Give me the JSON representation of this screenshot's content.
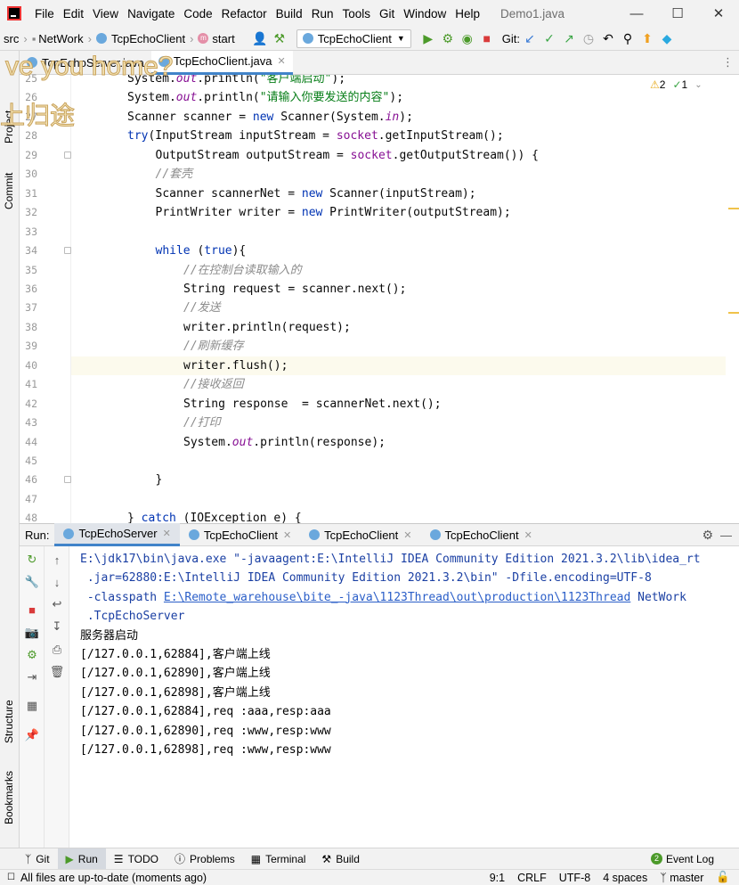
{
  "menu": [
    "File",
    "Edit",
    "View",
    "Navigate",
    "Code",
    "Refactor",
    "Build",
    "Run",
    "Tools",
    "Git",
    "Window",
    "Help"
  ],
  "window_title": "Demo1.java",
  "breadcrumbs": [
    "src",
    "NetWork",
    "TcpEchoClient",
    "start"
  ],
  "run_config": "TcpEchoClient",
  "git_label": "Git:",
  "editor_tabs": [
    {
      "label": "TcpEchoServer.java"
    },
    {
      "label": "TcpEchoClient.java"
    }
  ],
  "watermark": {
    "line1": "ve you home?",
    "line2": "上归途"
  },
  "inspection": {
    "warnings": "2",
    "weak": "1"
  },
  "side_labels": {
    "project": "Project",
    "commit": "Commit",
    "structure": "Structure",
    "bookmarks": "Bookmarks"
  },
  "code": [
    {
      "n": "25",
      "text": "System.out.println(\"客户端启动\");"
    },
    {
      "n": "26",
      "text": "System.out.println(\"请输入你要发送的内容\");"
    },
    {
      "n": "27",
      "text": "Scanner scanner = new Scanner(System.in);"
    },
    {
      "n": "28",
      "text": "try(InputStream inputStream = socket.getInputStream();"
    },
    {
      "n": "29",
      "text": "OutputStream outputStream = socket.getOutputStream()) {"
    },
    {
      "n": "30",
      "text": "//套壳"
    },
    {
      "n": "31",
      "text": "Scanner scannerNet = new Scanner(inputStream);"
    },
    {
      "n": "32",
      "text": "PrintWriter writer = new PrintWriter(outputStream);"
    },
    {
      "n": "33",
      "text": ""
    },
    {
      "n": "34",
      "text": "while (true){"
    },
    {
      "n": "35",
      "text": "//在控制台读取输入的"
    },
    {
      "n": "36",
      "text": "String request = scanner.next();"
    },
    {
      "n": "37",
      "text": "//发送"
    },
    {
      "n": "38",
      "text": "writer.println(request);"
    },
    {
      "n": "39",
      "text": "//刷新缓存"
    },
    {
      "n": "40",
      "text": "writer.flush();"
    },
    {
      "n": "41",
      "text": "//接收返回"
    },
    {
      "n": "42",
      "text": "String response  = scannerNet.next();"
    },
    {
      "n": "43",
      "text": "//打印"
    },
    {
      "n": "44",
      "text": "System.out.println(response);"
    },
    {
      "n": "45",
      "text": ""
    },
    {
      "n": "46",
      "text": "}"
    },
    {
      "n": "47",
      "text": ""
    },
    {
      "n": "48",
      "text": "} catch (IOException e) {"
    }
  ],
  "run_panel": {
    "label": "Run:",
    "tabs": [
      "TcpEchoServer",
      "TcpEchoClient",
      "TcpEchoClient",
      "TcpEchoClient"
    ]
  },
  "console": {
    "cmd1": "E:\\jdk17\\bin\\java.exe \"-javaagent:E:\\IntelliJ IDEA Community Edition 2021.3.2\\lib\\idea_rt",
    "cmd2": " .jar=62880:E:\\IntelliJ IDEA Community Edition 2021.3.2\\bin\" -Dfile.encoding=UTF-8",
    "cmd3_prefix": " -classpath ",
    "cmd3_link": "E:\\Remote_warehouse\\bite_-java\\1123Thread\\out\\production\\1123Thread",
    "cmd3_suffix": " NetWork",
    "cmd4": " .TcpEchoServer",
    "lines": [
      "服务器启动",
      "[/127.0.0.1,62884],客户端上线",
      "[/127.0.0.1,62890],客户端上线",
      "[/127.0.0.1,62898],客户端上线",
      "[/127.0.0.1,62884],req :aaa,resp:aaa",
      "[/127.0.0.1,62890],req :www,resp:www",
      "[/127.0.0.1,62898],req :www,resp:www"
    ]
  },
  "tool_windows": [
    "Git",
    "Run",
    "TODO",
    "Problems",
    "Terminal",
    "Build"
  ],
  "event_log": {
    "count": "2",
    "label": "Event Log"
  },
  "status": {
    "message": "All files are up-to-date (moments ago)",
    "position": "9:1",
    "line_sep": "CRLF",
    "encoding": "UTF-8",
    "indent": "4 spaces",
    "branch": "master"
  }
}
